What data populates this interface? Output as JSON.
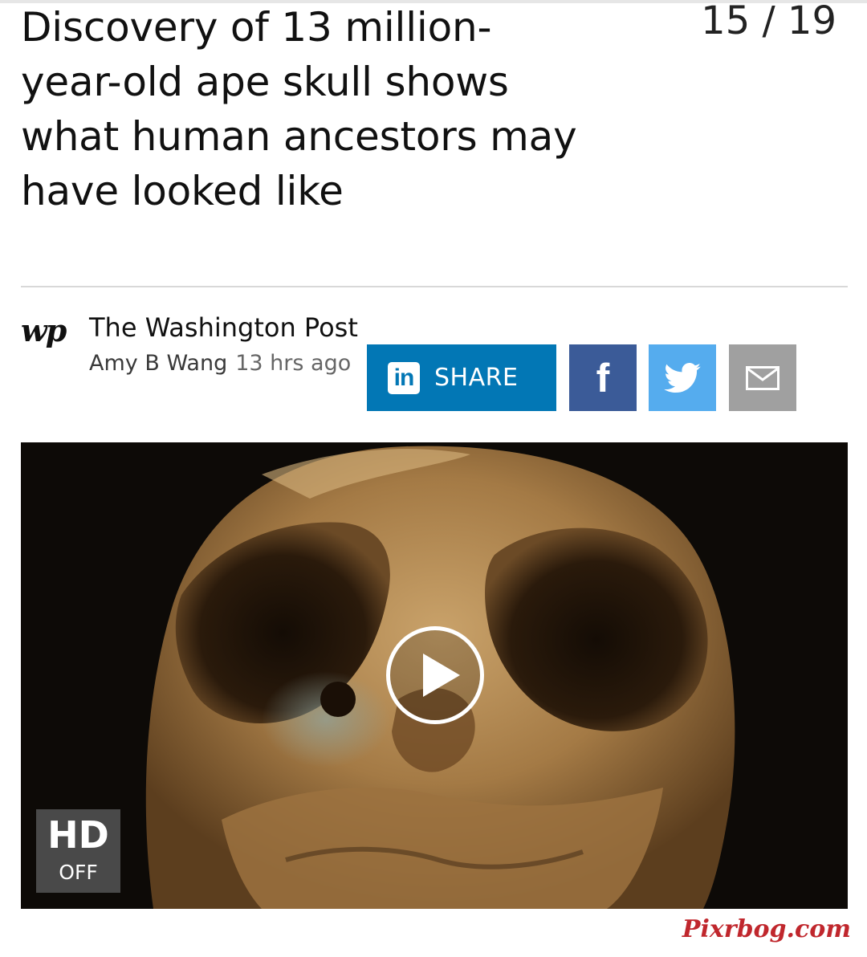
{
  "article": {
    "headline": "Discovery of 13 million-year-old ape skull shows what human ancestors may have looked like",
    "counter": "15 / 19"
  },
  "source": {
    "logo_text": "wp",
    "name": "The Washington Post",
    "author": "Amy B Wang",
    "time": "13 hrs ago"
  },
  "share": {
    "linkedin_icon": "in",
    "linkedin_label": "SHARE",
    "facebook_icon": "f",
    "icons": [
      "linkedin-icon",
      "facebook-icon",
      "twitter-icon",
      "email-icon"
    ],
    "colors": {
      "linkedin": "#0277b5",
      "facebook": "#3b5b98",
      "twitter": "#55acee",
      "email": "#a0a0a0"
    }
  },
  "video": {
    "hd_label": "HD",
    "hd_state": "OFF"
  },
  "watermark": "Pixrbog.com"
}
